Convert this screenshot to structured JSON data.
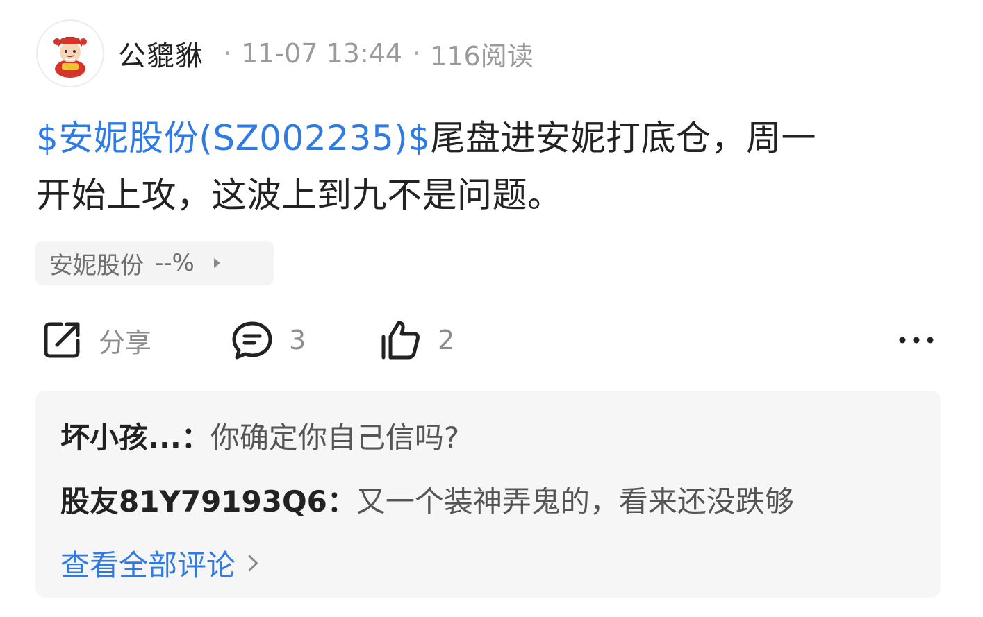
{
  "post": {
    "author": "公貔貅",
    "time": "11-07 13:44",
    "reads": "116阅读",
    "separator": "·",
    "stock_link": "$安妮股份(SZ002235)$",
    "text_line1_rest": "尾盘进安妮打底仓，周一",
    "text_line2": "开始上攻，这波上到九不是问题。"
  },
  "stock_chip": {
    "name": "安妮股份",
    "change": "--%"
  },
  "actions": {
    "share_label": "分享",
    "comment_count": "3",
    "like_count": "2"
  },
  "comments": {
    "items": [
      {
        "author": "坏小孩...：",
        "text": "你确定你自己信吗?"
      },
      {
        "author": "股友81Y79193Q6：",
        "text": "又一个装神弄鬼的，看来还没跌够"
      }
    ],
    "view_all": "查看全部评论"
  },
  "colors": {
    "link": "#2f7be5",
    "muted": "#9a9a9a",
    "comment_bg": "#f6f6f7"
  }
}
